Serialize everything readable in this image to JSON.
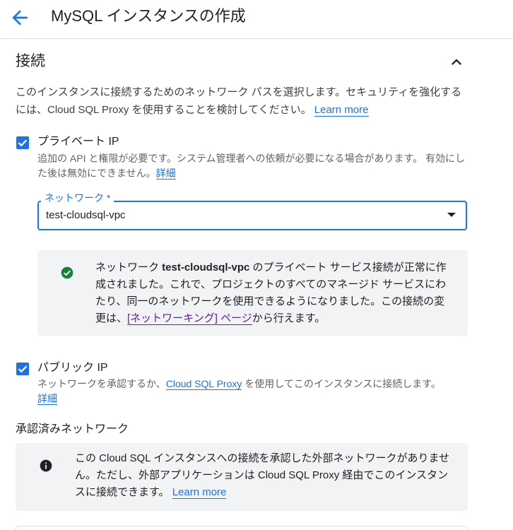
{
  "header": {
    "title": "MySQL インスタンスの作成"
  },
  "section": {
    "title": "接続",
    "description": "このインスタンスに接続するためのネットワーク パスを選択します。セキュリティを強化するには、Cloud SQL Proxy を使用することを検討してください。",
    "learn_more": "Learn more"
  },
  "private_ip": {
    "label": "プライベート IP",
    "checked": true,
    "helper": "追加の API と権限が必要です。システム管理者への依頼が必要になる場合があります。 有効にした後は無効にできません。",
    "details_link": "詳細"
  },
  "network_select": {
    "label": "ネットワーク *",
    "value": "test-cloudsql-vpc"
  },
  "success_callout": {
    "text_prefix": "ネットワーク ",
    "network_name": "test-cloudsql-vpc",
    "text_middle": " のプライベート サービス接続が正常に作成されました。これで、プロジェクトのすべてのマネージド サービスにわたり、同一のネットワークを使用できるようになりました。この接続の変更は、",
    "link": "[ネットワーキング] ページ",
    "text_suffix": "から行えます。"
  },
  "public_ip": {
    "label": "パブリック IP",
    "checked": true,
    "helper_prefix": "ネットワークを承認するか、",
    "proxy_link": "Cloud SQL Proxy",
    "helper_suffix": " を使用してこのインスタンスに接続します。",
    "details_link": "詳細"
  },
  "authorized_networks": {
    "title": "承認済みネットワーク",
    "info_text": "この Cloud SQL インスタンスへの接続を承認した外部ネットワークがありません。ただし、外部アプリケーションは Cloud SQL Proxy 経由でこのインスタンスに接続できます。",
    "learn_more": "Learn more"
  },
  "colors": {
    "accent": "#1a73e8",
    "success": "#188038",
    "callout_bg": "#f1f3f4",
    "visited_link": "#681da8"
  },
  "icons": {
    "back": "arrow-back-icon",
    "collapse": "chevron-up-icon",
    "success": "check-circle-icon",
    "info": "info-icon"
  }
}
